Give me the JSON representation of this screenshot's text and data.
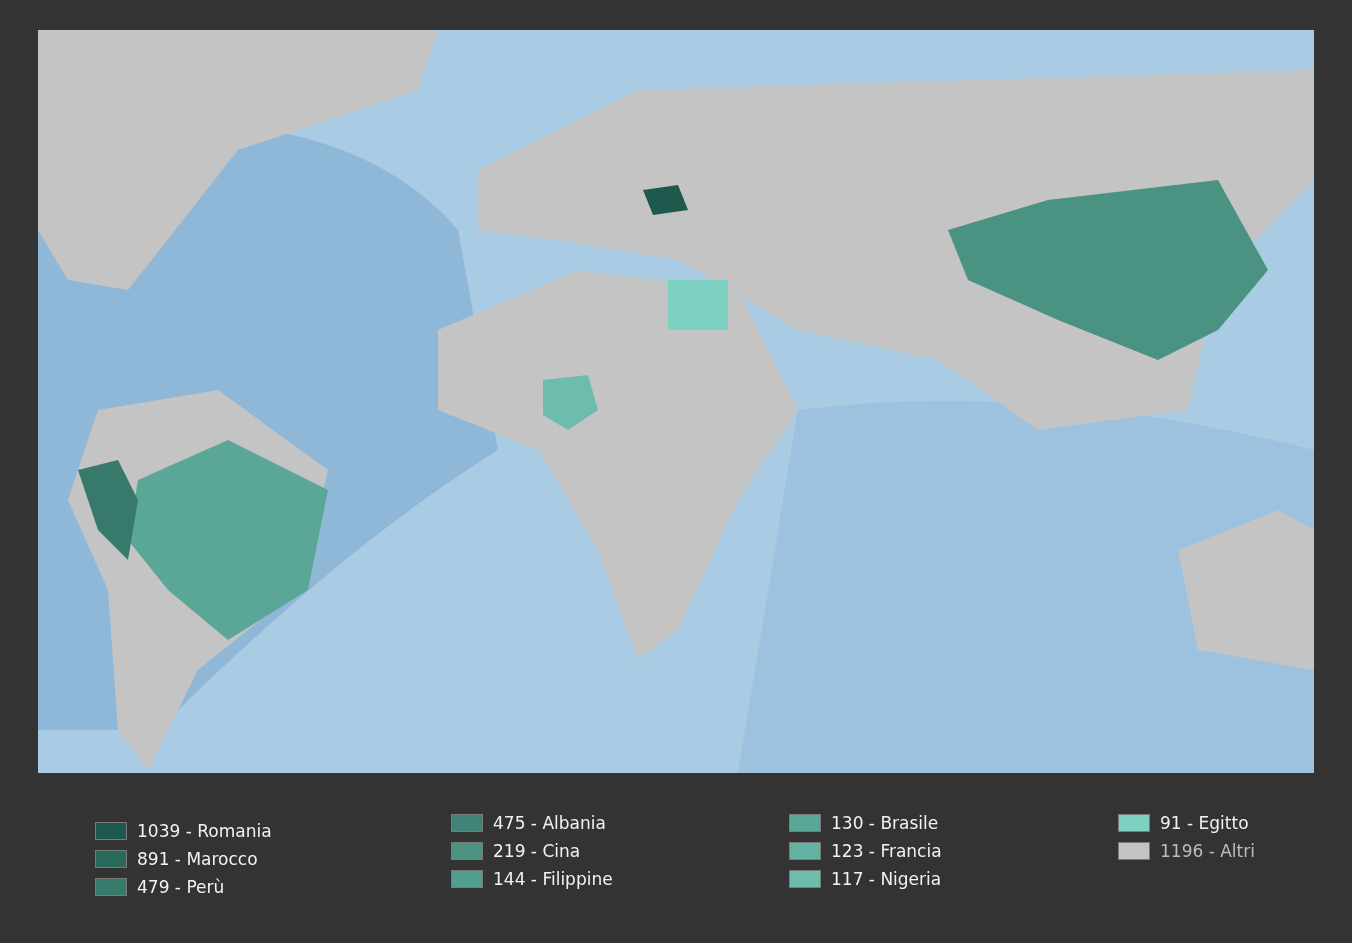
{
  "legend": {
    "columns": [
      {
        "items": [
          {
            "label": "1039 - Romania",
            "color": "#1d5a4d",
            "kind": "country"
          },
          {
            "label": "891 - Marocco",
            "color": "#2a6a5c",
            "kind": "country"
          },
          {
            "label": "479 - Perù",
            "color": "#377a6b",
            "kind": "country"
          }
        ]
      },
      {
        "items": [
          {
            "label": "475 - Albania",
            "color": "#3f8476",
            "kind": "country"
          },
          {
            "label": "219 - Cina",
            "color": "#4a9282",
            "kind": "country"
          },
          {
            "label": "144 - Filippine",
            "color": "#539d8d",
            "kind": "country"
          }
        ]
      },
      {
        "items": [
          {
            "label": "130 - Brasile",
            "color": "#5ba797",
            "kind": "country"
          },
          {
            "label": "123 - Francia",
            "color": "#64b1a1",
            "kind": "country"
          },
          {
            "label": "117 - Nigeria",
            "color": "#6dbdac",
            "kind": "country"
          }
        ]
      },
      {
        "items": [
          {
            "label": "91 - Egitto",
            "color": "#7dd1c0",
            "kind": "country"
          },
          {
            "label": "1196 - Altri",
            "color": "#c4c4c4",
            "kind": "other"
          }
        ]
      }
    ]
  }
}
